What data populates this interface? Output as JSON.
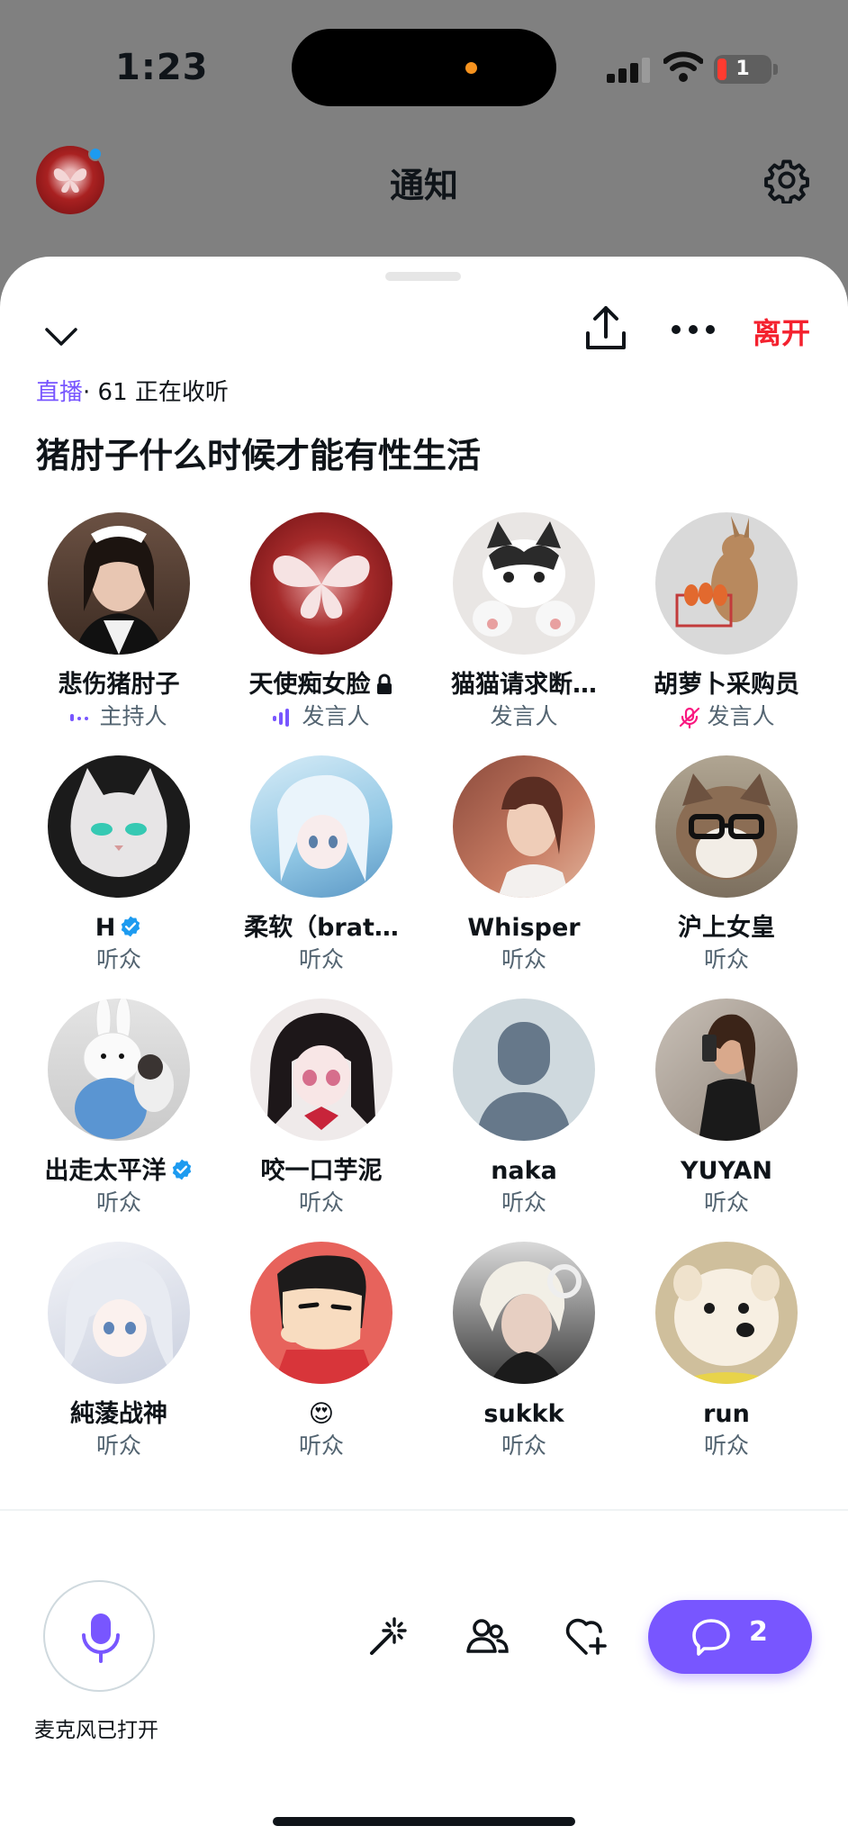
{
  "status_bar": {
    "time": "1:23",
    "battery": "1"
  },
  "background": {
    "title": "通知"
  },
  "sheet": {
    "leave_label": "离开",
    "live_label": "直播",
    "listening": "· 61 正在收听",
    "title": "猪肘子什么时候才能有性生活"
  },
  "participants": [
    {
      "name": "悲伤猪肘子",
      "role": "主持人"
    },
    {
      "name": "天使痴女脸",
      "role": "发言人"
    },
    {
      "name": "猫猫请求断…",
      "role": "发言人"
    },
    {
      "name": "胡萝卜采购员",
      "role": "发言人"
    },
    {
      "name": "H",
      "role": "听众"
    },
    {
      "name": "柔软（brat…",
      "role": "听众"
    },
    {
      "name": "Whisper",
      "role": "听众"
    },
    {
      "name": "沪上女皇",
      "role": "听众"
    },
    {
      "name": "出走太平洋",
      "role": "听众"
    },
    {
      "name": "咬一口芋泥",
      "role": "听众"
    },
    {
      "name": "naka",
      "role": "听众"
    },
    {
      "name": "YUYAN",
      "role": "听众"
    },
    {
      "name": "純蔆战神",
      "role": "听众"
    },
    {
      "name": "😍",
      "role": "听众"
    },
    {
      "name": "sukkk",
      "role": "听众"
    },
    {
      "name": "run",
      "role": "听众"
    }
  ],
  "bottom": {
    "mic_label": "麦克风已打开",
    "chat_count": "2"
  },
  "colors": {
    "accent": "#7856ff",
    "danger": "#f4212e",
    "verified": "#1d9bf0",
    "muted_icon": "#f91880"
  }
}
